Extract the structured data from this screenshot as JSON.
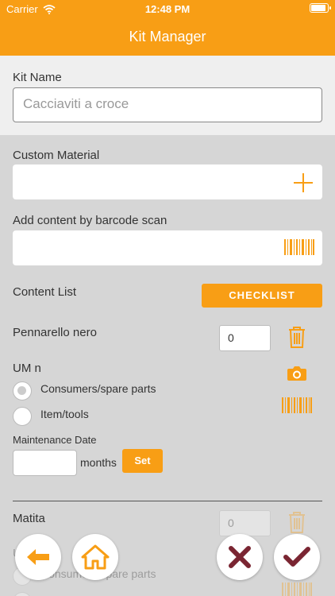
{
  "status_bar": {
    "carrier": "Carrier",
    "time": "12:48 PM"
  },
  "header": {
    "title": "Kit Manager"
  },
  "kit_name": {
    "label": "Kit Name",
    "value": "Cacciaviti a croce"
  },
  "custom_material": {
    "label": "Custom Material",
    "value": ""
  },
  "barcode_scan": {
    "label": "Add content by barcode scan",
    "value": ""
  },
  "content_list": {
    "label": "Content List",
    "checklist_button": "CHECKLIST"
  },
  "items": [
    {
      "name": "Pennarello nero",
      "quantity": "0",
      "um_label": "UM n",
      "type_options": [
        "Consumers/spare parts",
        "Item/tools"
      ],
      "maintenance_label": "Maintenance Date",
      "maintenance_value": "",
      "months_label": "months",
      "set_button": "Set"
    },
    {
      "name": "Matita",
      "quantity": "0",
      "um_label": "U",
      "type_options": [
        "Consumers/spare parts"
      ]
    }
  ],
  "colors": {
    "accent": "#f89e15",
    "cancel": "#7a2532",
    "confirm": "#7a2532"
  },
  "icons": {
    "back": "arrow-left-icon",
    "home": "home-icon",
    "cancel": "x-icon",
    "confirm": "checkmark-icon",
    "trash": "trash-icon",
    "camera": "camera-icon",
    "barcode": "barcode-icon",
    "plus": "plus-icon"
  }
}
